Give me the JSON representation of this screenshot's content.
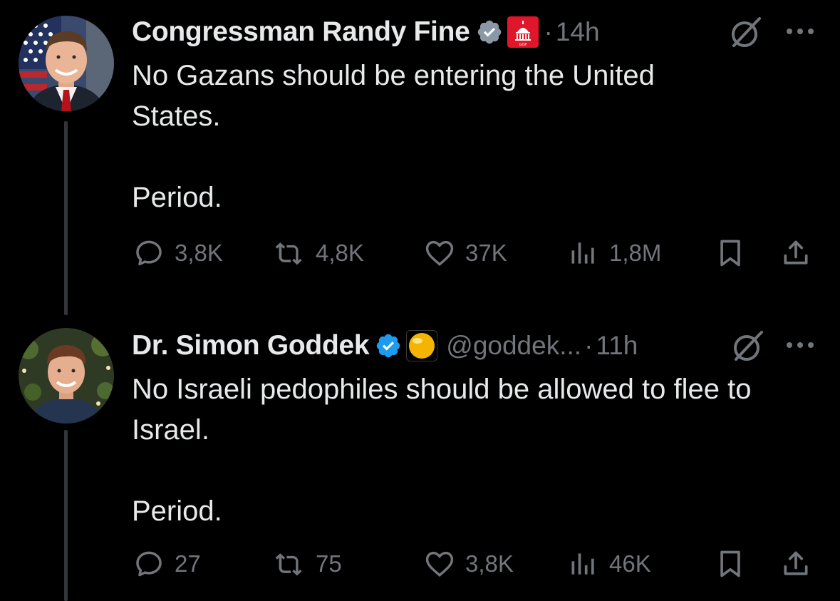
{
  "tweets": [
    {
      "display_name": "Congressman Randy Fine",
      "handle": "",
      "separator": "·",
      "time": "14h",
      "verified_color": "#8b98a5",
      "affiliation_badge": "capitol-gop-badge",
      "body_line1": "No Gazans should be entering the United States.",
      "body_line2": "Period.",
      "stats": {
        "replies": "3,8K",
        "retweets": "4,8K",
        "likes": "37K",
        "views": "1,8M"
      }
    },
    {
      "display_name": "Dr. Simon Goddek",
      "handle": "@goddek...",
      "separator": "·",
      "time": "11h",
      "verified_color": "#1d9bf0",
      "affiliation_badge": "yellow-circle-emoji",
      "body_line1": "No Israeli pedophiles should be allowed to flee to Israel.",
      "body_line2": "Period.",
      "stats": {
        "replies": "27",
        "retweets": "75",
        "likes": "3,8K",
        "views": "46K"
      }
    }
  ],
  "colors": {
    "background": "#000000",
    "text": "#e7e9ea",
    "muted": "#71767b",
    "thread_line": "#333639"
  }
}
